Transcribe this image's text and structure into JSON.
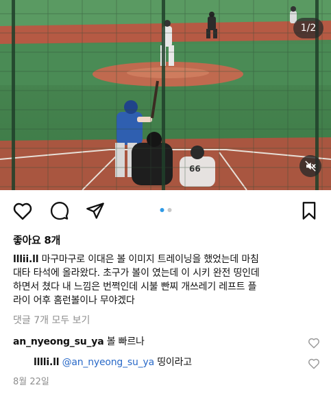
{
  "media": {
    "counter": "1/2",
    "batter_number": "66",
    "icons": {
      "mute": "speaker-muted-icon"
    }
  },
  "actions": {
    "icons": [
      "heart-icon",
      "comment-icon",
      "share-icon",
      "bookmark-icon"
    ],
    "carousel": {
      "total": 2,
      "active": 1
    },
    "accent_color": "#2f9ae6"
  },
  "post": {
    "likes": "좋아요 8개",
    "username": "lllii.ll",
    "caption_lines": [
      " 마구마구로 이대은 볼 이미지 트레이닝을 했었는데 마침",
      "대타 타석에 올라왔다. 초구가 볼이 였는데 이 시키 완전 띵인데",
      "하면서 쳤다 내 느낌은 번쩍인데 시불 빤찌 개쓰레기 레프트 플",
      "라이 어후 홈런볼이나 무야겠다"
    ],
    "view_comments": "댓글 7개 모두 보기",
    "date": "8월 22일"
  },
  "comments": [
    {
      "user": "an_nyeong_su_ya",
      "text": " 볼 빠르나",
      "mention": ""
    },
    {
      "user": "lllli.ll",
      "mention": " @an_nyeong_su_ya",
      "text": " 띵이라고"
    }
  ]
}
